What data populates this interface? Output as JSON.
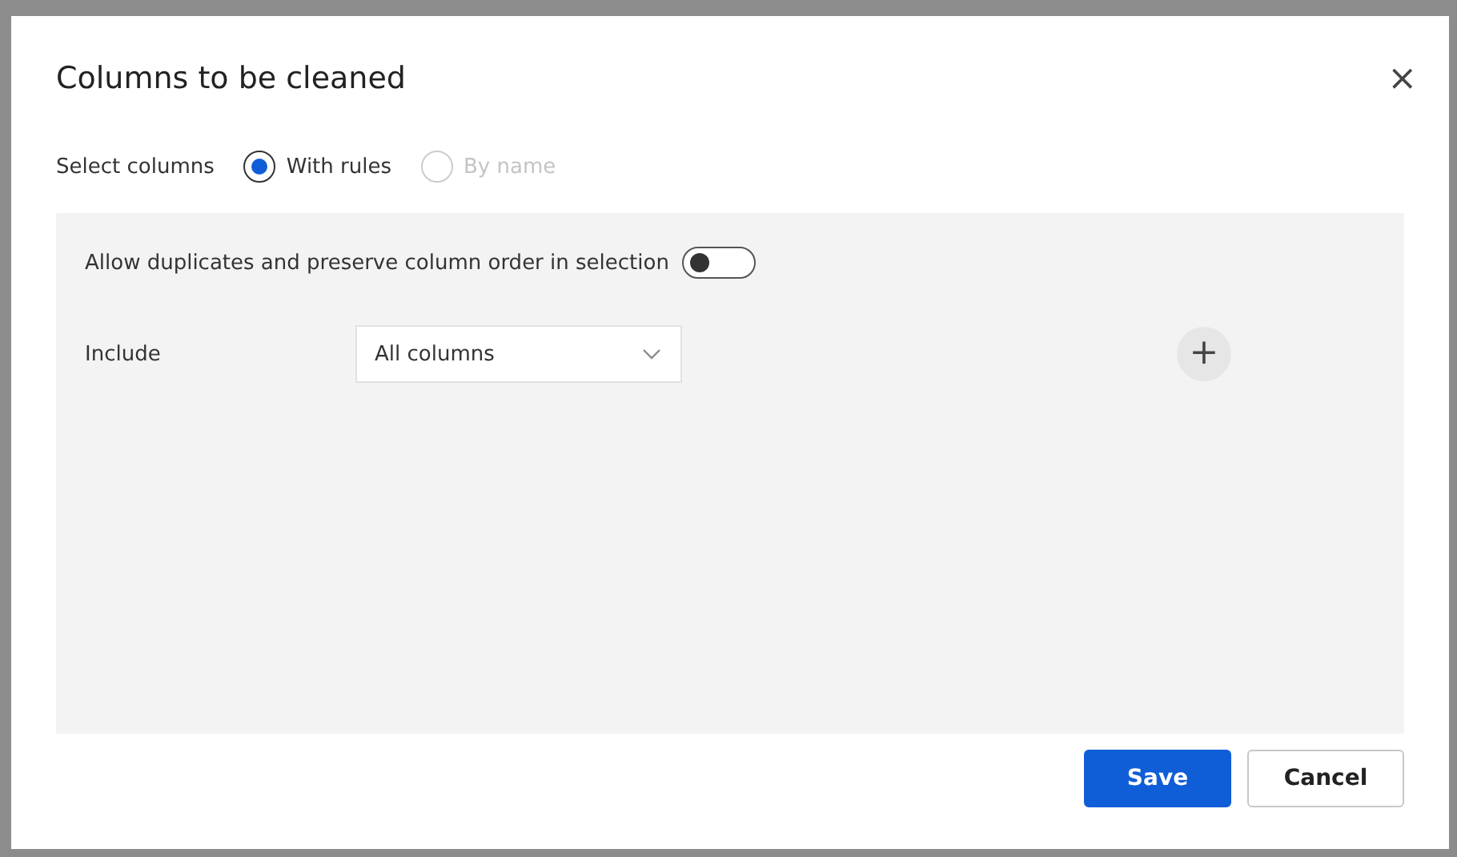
{
  "dialog": {
    "title": "Columns to be cleaned",
    "close": "×"
  },
  "select_columns": {
    "label": "Select columns",
    "options": [
      {
        "label": "With rules",
        "selected": true,
        "disabled": false
      },
      {
        "label": "By name",
        "selected": false,
        "disabled": true
      }
    ]
  },
  "rules": {
    "toggle": {
      "label": "Allow duplicates and preserve column order in selection",
      "on": false
    },
    "include": {
      "label": "Include",
      "value": "All columns"
    },
    "add": "+"
  },
  "buttons": [
    {
      "label": "Save",
      "kind": "primary"
    },
    {
      "label": "Cancel",
      "kind": "secondary"
    }
  ]
}
